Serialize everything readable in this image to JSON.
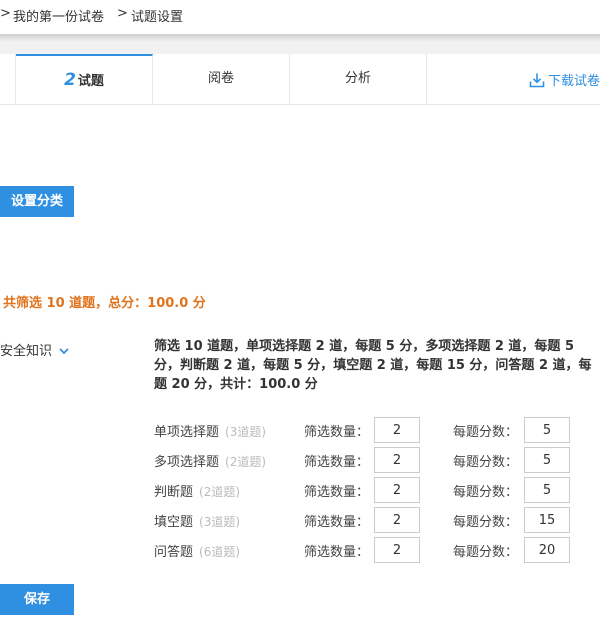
{
  "breadcrumb": {
    "sep1": ">",
    "paper": "我的第一份试卷",
    "sep2": ">",
    "page": "试题设置"
  },
  "tabs": [
    {
      "num": "2",
      "label": "试题"
    },
    {
      "label": "阅卷"
    },
    {
      "label": "分析"
    }
  ],
  "download_label": "下载试卷",
  "set_category_label": "设置分类",
  "summary": "共筛选 10 道题，总分：100.0 分",
  "category": {
    "name": "安全知识",
    "icon": "chevron-down-icon"
  },
  "description": "筛选 10 道题，单项选择题 2 道，每题 5 分，多项选择题 2 道，每题 5 分，判断题 2 道，每题 5 分，填空题 2 道，每题 15 分，问答题 2 道，每题 20 分，共计：100.0 分",
  "labels": {
    "filter_count": "筛选数量：",
    "score_each": "每题分数："
  },
  "rows": [
    {
      "name": "单项选择题",
      "count": "(3道题)",
      "filter": "2",
      "score": "5"
    },
    {
      "name": "多项选择题",
      "count": "(2道题)",
      "filter": "2",
      "score": "5"
    },
    {
      "name": "判断题",
      "count": "(2道题)",
      "filter": "2",
      "score": "5"
    },
    {
      "name": "填空题",
      "count": "(3道题)",
      "filter": "2",
      "score": "15"
    },
    {
      "name": "问答题",
      "count": "(6道题)",
      "filter": "2",
      "score": "20"
    }
  ],
  "save_label": "保存",
  "colors": {
    "accent": "#2f8fe0",
    "summary": "#e0731b"
  }
}
